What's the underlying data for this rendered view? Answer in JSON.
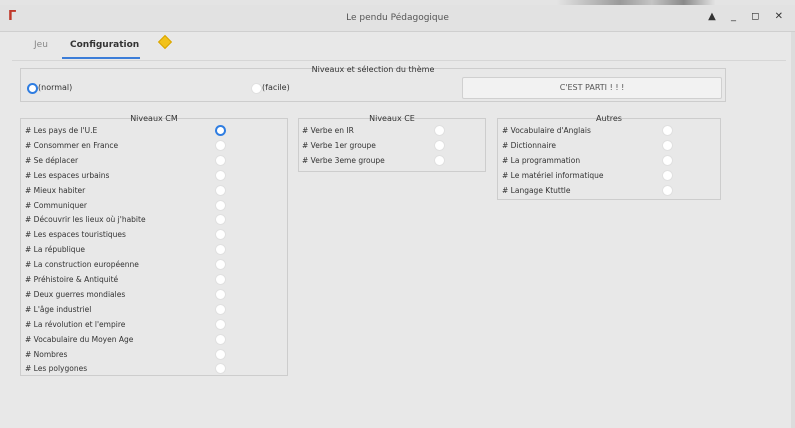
{
  "window": {
    "title": "Le pendu Pédagogique",
    "icon": "app-icon",
    "controls": "▲ _ ◻ ✕"
  },
  "tabs": [
    {
      "label": "Jeu"
    },
    {
      "label": "Configuration"
    }
  ],
  "levels_section": {
    "title": "Niveaux et sélection du thème",
    "options": [
      {
        "label": "(normal)",
        "selected": true
      },
      {
        "label": "(facile)",
        "selected": false
      }
    ],
    "start_button": "C'EST PARTI ! ! !"
  },
  "cm": {
    "title": "Niveaux CM",
    "items": [
      {
        "label": "# Les pays de l'U.E",
        "selected": true
      },
      {
        "label": "# Consommer en France",
        "selected": false
      },
      {
        "label": "# Se déplacer",
        "selected": false
      },
      {
        "label": "# Les espaces urbains",
        "selected": false
      },
      {
        "label": "# Mieux habiter",
        "selected": false
      },
      {
        "label": "# Communiquer",
        "selected": false
      },
      {
        "label": "# Découvrir les lieux où j'habite",
        "selected": false
      },
      {
        "label": "# Les espaces touristiques",
        "selected": false
      },
      {
        "label": "# La république",
        "selected": false
      },
      {
        "label": "# La construction européenne",
        "selected": false
      },
      {
        "label": "# Préhistoire & Antiquité",
        "selected": false
      },
      {
        "label": "# Deux guerres mondiales",
        "selected": false
      },
      {
        "label": "# L'âge industriel",
        "selected": false
      },
      {
        "label": "# La révolution et l'empire",
        "selected": false
      },
      {
        "label": "# Vocabulaire du Moyen Age",
        "selected": false
      },
      {
        "label": "# Nombres",
        "selected": false
      },
      {
        "label": "# Les polygones",
        "selected": false
      }
    ]
  },
  "ce": {
    "title": "Niveaux CE",
    "items": [
      {
        "label": "# Verbe en IR",
        "selected": false
      },
      {
        "label": "# Verbe 1er groupe",
        "selected": false
      },
      {
        "label": "# Verbe 3eme groupe",
        "selected": false
      }
    ]
  },
  "autres": {
    "title": "Autres",
    "items": [
      {
        "label": "# Vocabulaire d'Anglais",
        "selected": false
      },
      {
        "label": "# Dictionnaire",
        "selected": false
      },
      {
        "label": "# La programmation",
        "selected": false
      },
      {
        "label": "# Le matériel informatique",
        "selected": false
      },
      {
        "label": "# Langage Ktuttle",
        "selected": false
      }
    ]
  },
  "colors": {
    "accent": "#2f7de1",
    "tab_marker": "#f2c21b"
  }
}
